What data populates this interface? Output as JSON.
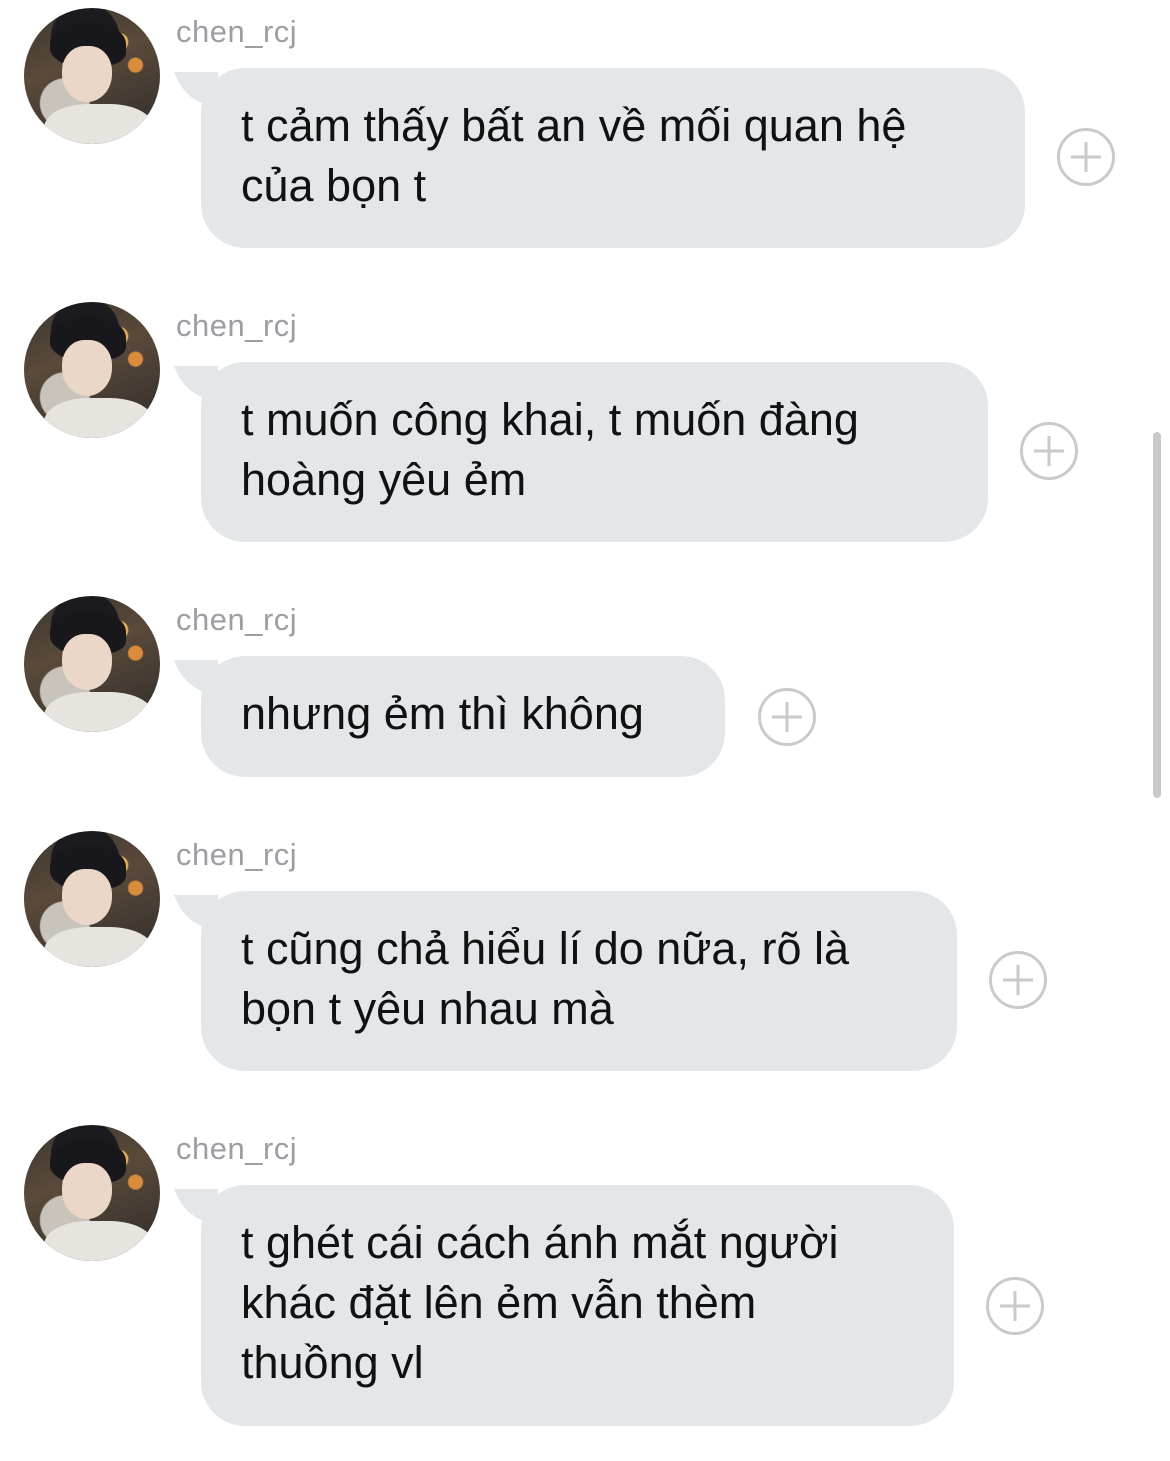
{
  "messages": [
    {
      "username": "chen_rcj",
      "text": "t cảm thấy bất an về mối quan hệ\ncủa bọn t",
      "avatar_icon": "avatar-photo",
      "action_icon": "add-reaction-icon"
    },
    {
      "username": "chen_rcj",
      "text": "t muốn công khai, t muốn đàng\nhoàng yêu ẻm",
      "avatar_icon": "avatar-photo",
      "action_icon": "add-reaction-icon"
    },
    {
      "username": "chen_rcj",
      "text": "nhưng ẻm thì không",
      "avatar_icon": "avatar-photo",
      "action_icon": "add-reaction-icon"
    },
    {
      "username": "chen_rcj",
      "text": "t cũng chả hiểu lí do nữa, rõ là\nbọn t yêu nhau mà",
      "avatar_icon": "avatar-photo",
      "action_icon": "add-reaction-icon"
    },
    {
      "username": "chen_rcj",
      "text": "t ghét cái cách ánh mắt người\nkhác đặt lên ẻm vẫn thèm\nthuồng vl",
      "avatar_icon": "avatar-photo",
      "action_icon": "add-reaction-icon"
    }
  ],
  "colors": {
    "bubble": "#e4e7ea",
    "username": "#9b9ea3",
    "text": "#111111",
    "icon": "#c9cacc"
  }
}
